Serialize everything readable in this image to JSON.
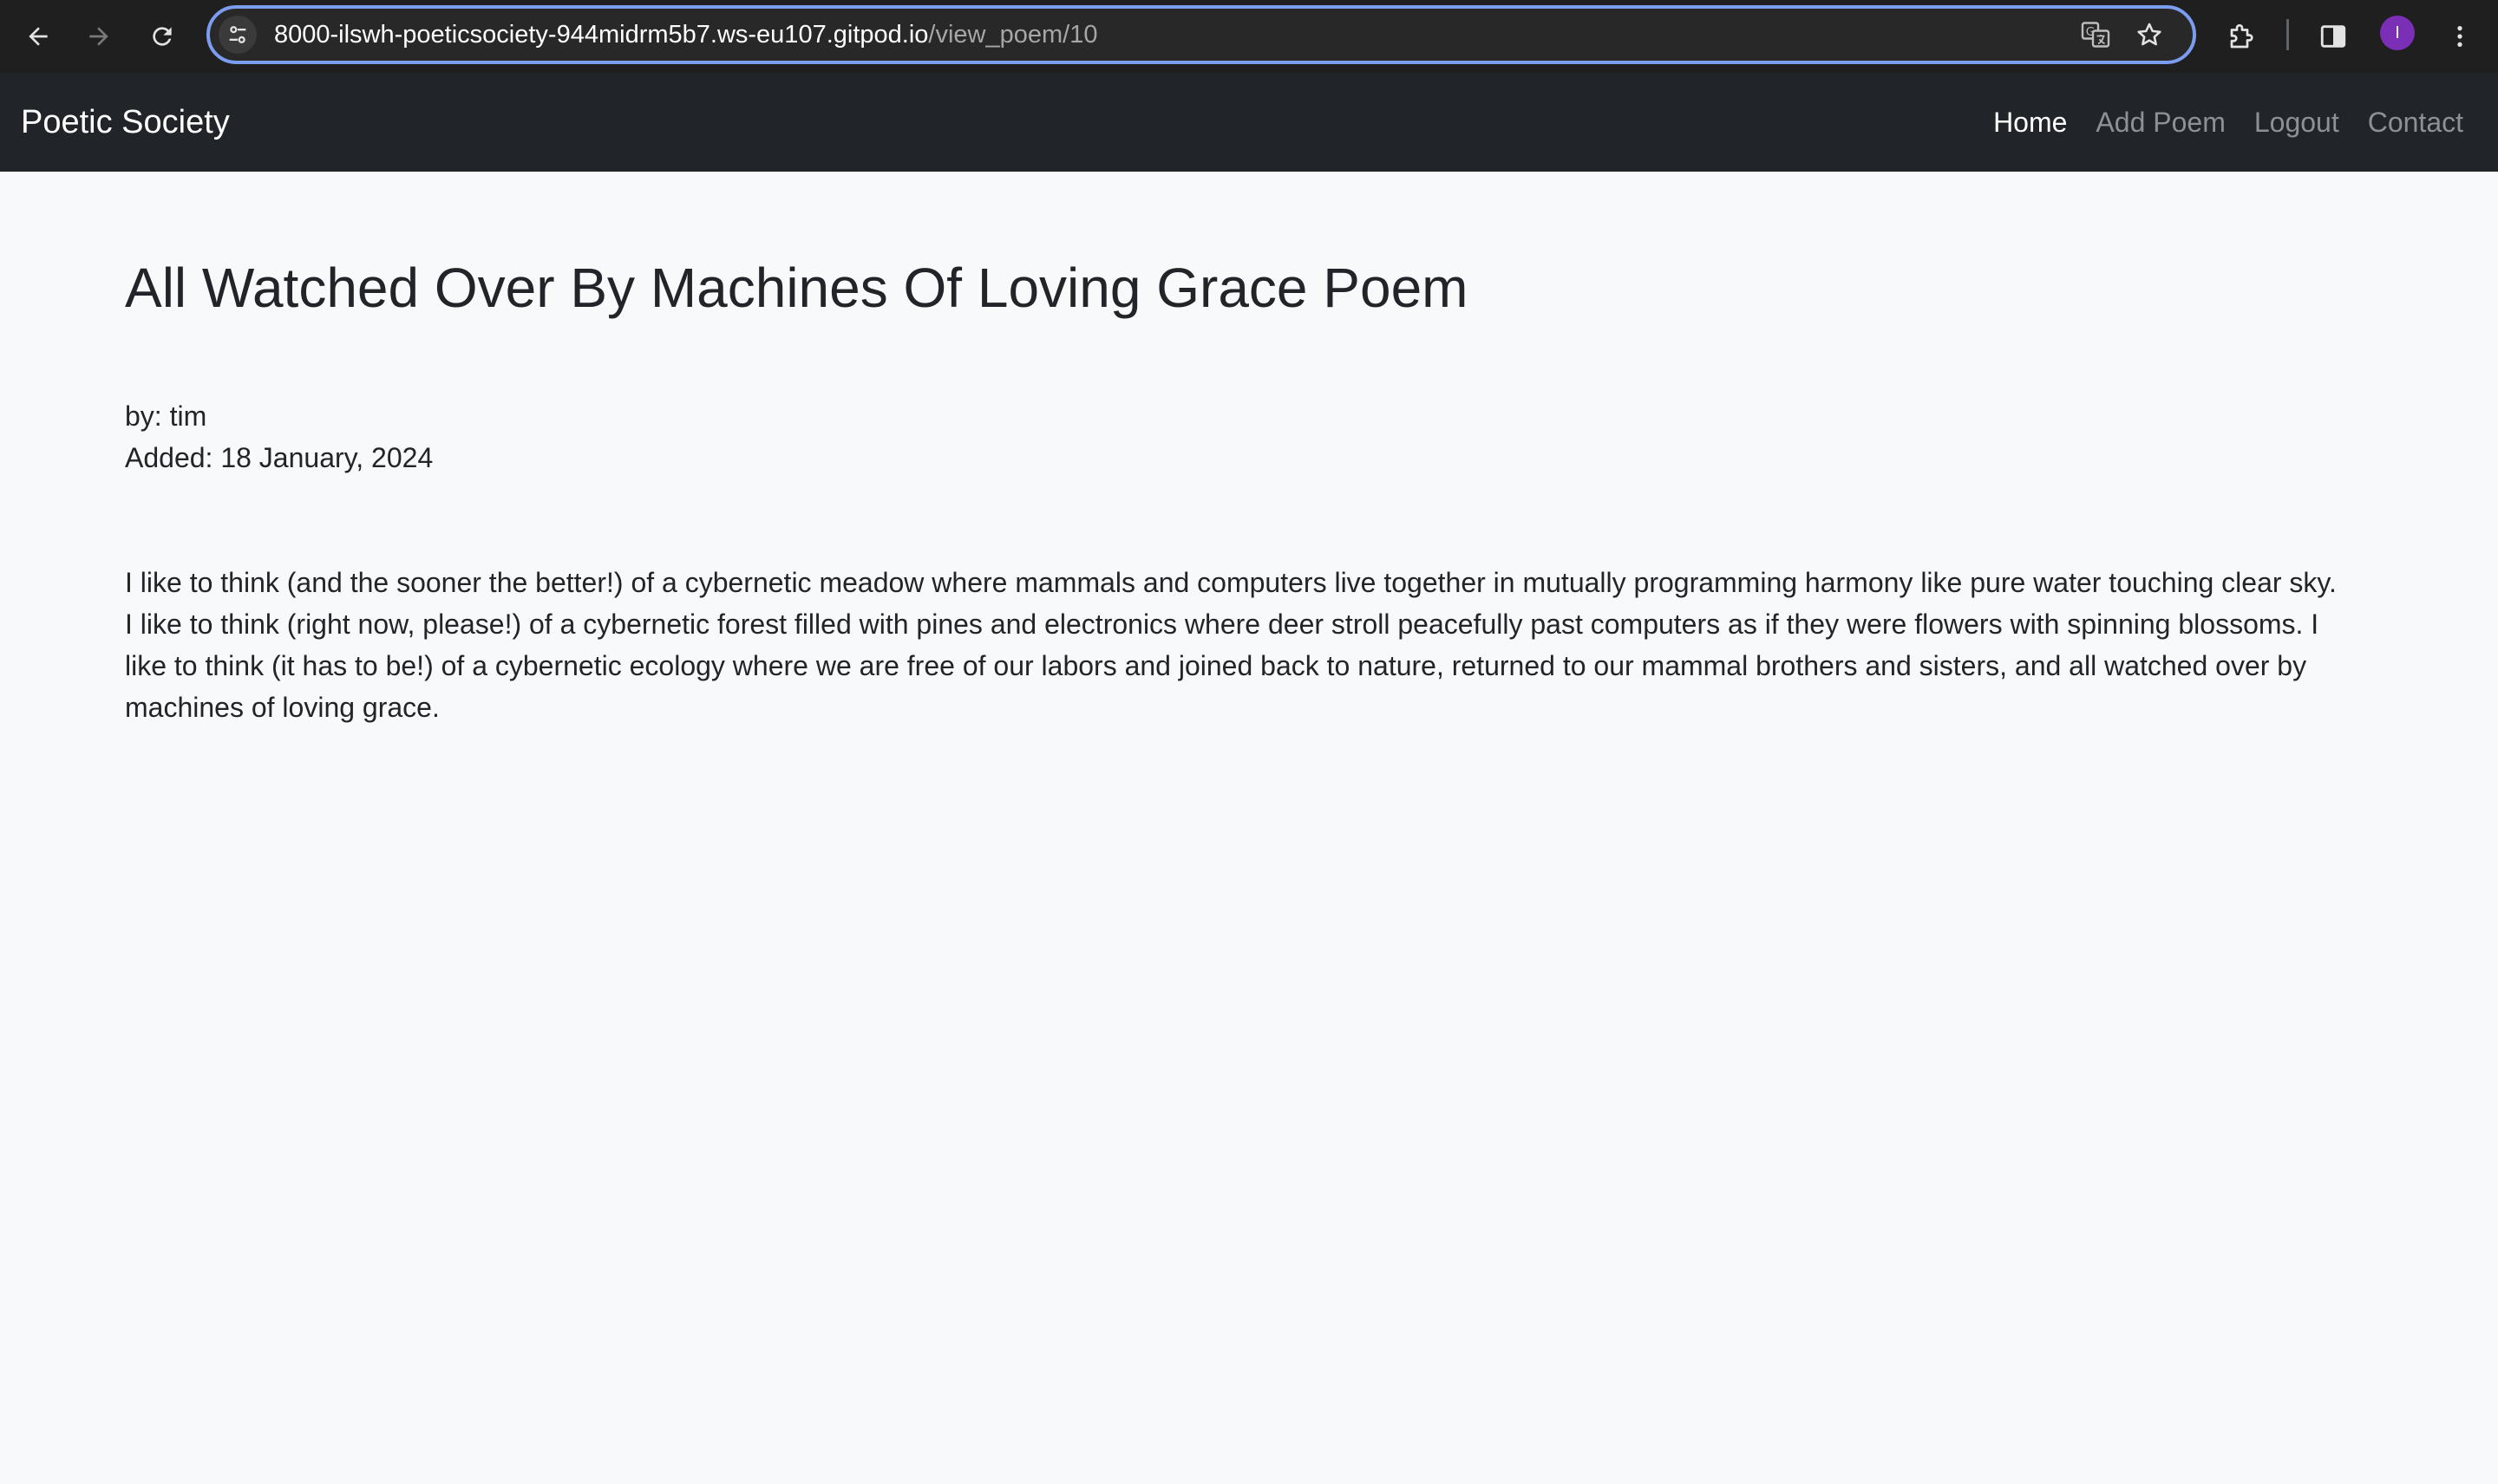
{
  "browser": {
    "url_host": "8000-ilswh-poeticsociety-944midrm5b7.ws-eu107.gitpod.io",
    "url_path": "/view_poem/10",
    "avatar_letter": "I"
  },
  "navbar": {
    "brand": "Poetic Society",
    "links": [
      {
        "label": "Home",
        "active": true
      },
      {
        "label": "Add Poem",
        "active": false
      },
      {
        "label": "Logout",
        "active": false
      },
      {
        "label": "Contact",
        "active": false
      }
    ]
  },
  "poem": {
    "title": "All Watched Over By Machines Of Loving Grace Poem",
    "author_line": "by: tim",
    "added_line": "Added: 18 January, 2024",
    "body": "I like to think (and the sooner the better!) of a cybernetic meadow where mammals and computers live together in mutually programming harmony like pure water touching clear sky. I like to think (right now, please!) of a cybernetic forest filled with pines and electronics where deer stroll peacefully past computers as if they were flowers with spinning blossoms. I like to think (it has to be!) of a cybernetic ecology where we are free of our labors and joined back to nature, returned to our mammal brothers and sisters, and all watched over by machines of loving grace."
  },
  "colors": {
    "navbar_bg": "#212529",
    "page_bg": "#f8f9fa",
    "link_muted": "#8c9196",
    "link_active": "#ffffff",
    "focus_ring": "#7c9cf0"
  },
  "icons": {
    "back": "back-arrow-icon",
    "forward": "forward-arrow-icon",
    "reload": "reload-icon",
    "site_info": "tune-icon",
    "translate": "translate-icon",
    "bookmark": "star-icon",
    "extensions": "puzzle-icon",
    "side_panel": "side-panel-icon",
    "menu": "more-vert-icon"
  }
}
